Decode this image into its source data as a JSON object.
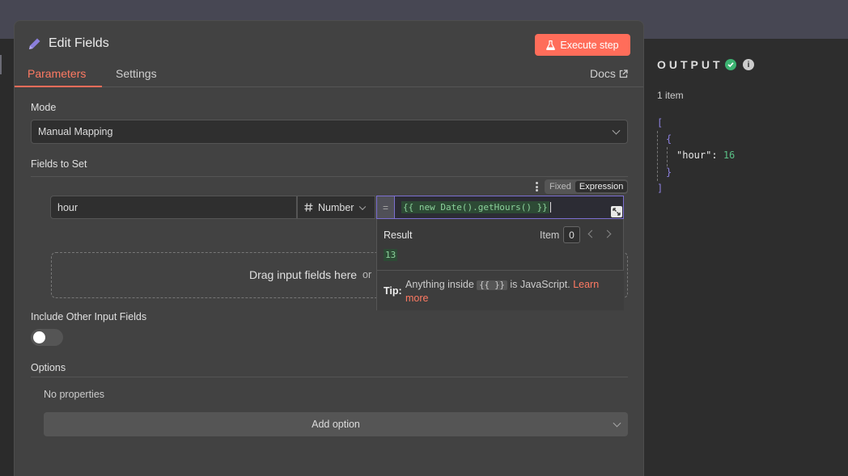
{
  "header": {
    "title": "Edit Fields",
    "execute_label": "Execute step",
    "tabs": {
      "parameters": "Parameters",
      "settings": "Settings"
    },
    "docs_label": "Docs"
  },
  "mode": {
    "label": "Mode",
    "value": "Manual Mapping"
  },
  "fields": {
    "label": "Fields to Set",
    "toggle_fixed": "Fixed",
    "toggle_expression": "Expression",
    "row": {
      "name": "hour",
      "type": "Number",
      "expression": "{{ new Date().getHours() }}"
    },
    "drop_text": "Drag input fields here",
    "drop_or": "or"
  },
  "popover": {
    "result_label": "Result",
    "item_label": "Item",
    "item_index": "0",
    "result_value": "13",
    "tip_label": "Tip:",
    "tip_prefix": "Anything inside",
    "tip_code": "{{ }}",
    "tip_suffix": "is JavaScript.",
    "tip_link": "Learn more"
  },
  "include_other": {
    "label": "Include Other Input Fields",
    "enabled": false
  },
  "options": {
    "label": "Options",
    "empty_text": "No properties",
    "add_label": "Add option"
  },
  "output": {
    "title": "OUTPUT",
    "count": "1 item",
    "json": {
      "open_bracket": "[",
      "open_brace": "{",
      "key": "\"hour\":",
      "value": "16",
      "close_brace": "}",
      "close_bracket": "]"
    }
  },
  "colors": {
    "accent": "#ff6d5a",
    "expression_border": "#7c6fd1",
    "success": "#3cb371"
  },
  "icons": [
    "pencil-icon",
    "flask-icon",
    "external-link-icon",
    "hash-icon",
    "kebab-icon",
    "expand-icon",
    "check-circle-icon",
    "info-icon"
  ]
}
